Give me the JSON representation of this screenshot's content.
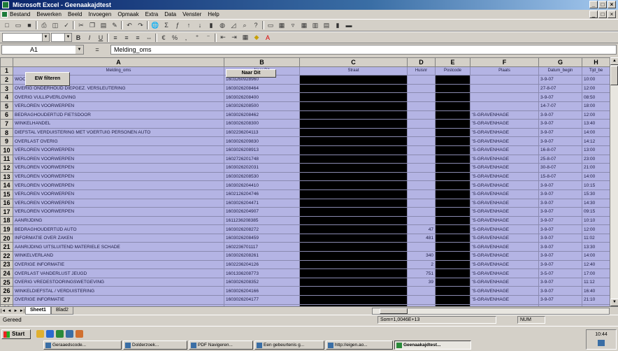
{
  "window": {
    "title": "Microsoft Excel - Geenaakajdtest"
  },
  "menu": [
    "Bestand",
    "Bewerken",
    "Beeld",
    "Invoegen",
    "Opmaak",
    "Extra",
    "Data",
    "Venster",
    "Help"
  ],
  "formula_bar": {
    "name_box": "A1",
    "fx": "=",
    "content": "Melding_oms"
  },
  "columns": [
    "A",
    "B",
    "C",
    "D",
    "E",
    "F",
    "G",
    "H"
  ],
  "header_row": {
    "num": "1",
    "cells": [
      "Melding_oms",
      "Naar Dit",
      "Straat",
      "Huisnr",
      "Postcode",
      "Plaats",
      "Datum_begin",
      "Tijd_be"
    ]
  },
  "buttons": {
    "ew": "EW filteren",
    "naar": "Naar Dit"
  },
  "rows": [
    {
      "n": "2",
      "a": "WOONLAGEN ZAKEN",
      "b": "1603260928960",
      "d": "",
      "f": "",
      "g": "3-9-07",
      "h": "10:00"
    },
    {
      "n": "3",
      "a": "OVERIG ONDERHOUD DIEPGEZ. VERSLEUTERING",
      "b": "1603026208464",
      "d": "",
      "f": "",
      "g": "27-8-07",
      "h": "12:00"
    },
    {
      "n": "4",
      "a": "OVERIG VULLIPVERLOVING",
      "b": "1603026208400",
      "d": "",
      "f": "",
      "g": "3-9-07",
      "h": "08:50"
    },
    {
      "n": "5",
      "a": "VERLOREN VOORWERPEN",
      "b": "1603026208500",
      "d": "",
      "f": "",
      "g": "14-7-07",
      "h": "18:00"
    },
    {
      "n": "6",
      "a": "BEDRAGHOUDERTIJD FIETSDOOR",
      "b": "1603026208462",
      "d": "",
      "f": "'S-GRAVENHAGE",
      "g": "3-9-07",
      "h": "12:00"
    },
    {
      "n": "7",
      "a": "WINKELHANDEL",
      "b": "1603026208300",
      "d": "",
      "f": "'S-GRAVENHAGE",
      "g": "3-9-07",
      "h": "13:40"
    },
    {
      "n": "8",
      "a": "DIEFSTAL VERDUISTERING MET VOERTUIG PERSONEN AUTO",
      "b": "1602236204113",
      "d": "",
      "f": "'S-GRAVENHAGE",
      "g": "3-9-07",
      "h": "14:00"
    },
    {
      "n": "9",
      "a": "OVERLAST OVERIG",
      "b": "1603026209830",
      "d": "",
      "f": "'S-GRAVENHAGE",
      "g": "3-9-07",
      "h": "14:12"
    },
    {
      "n": "10",
      "a": "VERLOREN VOORWERPEN",
      "b": "1603026208913",
      "d": "",
      "f": "'S-GRAVENHAGE",
      "g": "16-8-07",
      "h": "13:00"
    },
    {
      "n": "11",
      "a": "VERLOREN VOORWERPEN",
      "b": "1602726201748",
      "d": "",
      "f": "'S-GRAVENHAGE",
      "g": "25-8-07",
      "h": "23:00"
    },
    {
      "n": "12",
      "a": "VERLOREN VOORWERPEN",
      "b": "1603026202031",
      "d": "",
      "f": "'S-GRAVENHAGE",
      "g": "30-8-07",
      "h": "21:00"
    },
    {
      "n": "13",
      "a": "VERLOREN VOORWERPEN",
      "b": "1603026208530",
      "d": "",
      "f": "'S-GRAVENHAGE",
      "g": "15-8-07",
      "h": "14:00"
    },
    {
      "n": "14",
      "a": "VERLOREN VOORWERPEN",
      "b": "1603026204410",
      "d": "",
      "f": "'S-GRAVENHAGE",
      "g": "3-9-07",
      "h": "10:15"
    },
    {
      "n": "15",
      "a": "VERLOREN VOORWERPEN",
      "b": "1602126204746",
      "d": "",
      "f": "'S-GRAVENHAGE",
      "g": "3-9-07",
      "h": "15:30"
    },
    {
      "n": "16",
      "a": "VERLOREN VOORWERPEN",
      "b": "1603026204471",
      "d": "",
      "f": "'S-GRAVENHAGE",
      "g": "3-9-07",
      "h": "14:30"
    },
    {
      "n": "17",
      "a": "VERLOREN VOORWERPEN",
      "b": "1603026204907",
      "d": "",
      "f": "'S-GRAVENHAGE",
      "g": "3-9-07",
      "h": "09:15"
    },
    {
      "n": "18",
      "a": "AANRIJDING",
      "b": "1611236208385",
      "d": "",
      "f": "'S-GRAVENHAGE",
      "g": "3-9-07",
      "h": "10:10"
    },
    {
      "n": "19",
      "a": "BEDRAGHOUDERTIJD AUTO",
      "b": "1603026208272",
      "d": "47",
      "f": "'S-GRAVENHAGE",
      "g": "3-9-07",
      "h": "12:00"
    },
    {
      "n": "20",
      "a": "INFORMATIE OVER ZAKEN",
      "b": "1603026208459",
      "d": "481",
      "f": "'S-GRAVENHAGE",
      "g": "3-9-07",
      "h": "11:02"
    },
    {
      "n": "21",
      "a": "AANRIJDING UITSLUITEND MATERIELE SCHADE",
      "b": "1602236701117",
      "d": "",
      "f": "'S-GRAVENHAGE",
      "g": "3-9-07",
      "h": "13:30"
    },
    {
      "n": "22",
      "a": "WINKELVERLAND",
      "b": "1603026208261",
      "d": "340",
      "f": "'S-GRAVENHAGE",
      "g": "3-9-07",
      "h": "14:00"
    },
    {
      "n": "23",
      "a": "OVERIGE INFORMATIE",
      "b": "1602236204126",
      "d": "2",
      "f": "'S-GRAVENHAGE",
      "g": "3-9-07",
      "h": "12:40"
    },
    {
      "n": "24",
      "a": "OVERLAST VANDERLUST JEUGD",
      "b": "1601336208773",
      "d": "751",
      "f": "'S-GRAVENHAGE",
      "g": "3-5-07",
      "h": "17:00"
    },
    {
      "n": "25",
      "a": "OVERIG VREDESTOORINGSWETGEVING",
      "b": "1603026208352",
      "d": "39",
      "f": "'S-GRAVENHAGE",
      "g": "3-9-07",
      "h": "11:12"
    },
    {
      "n": "26",
      "a": "WINKELDIEFSTAL / VERDUISTERING",
      "b": "1603026204166",
      "d": "",
      "f": "'S-GRAVENHAGE",
      "g": "3-9-07",
      "h": "16:40"
    },
    {
      "n": "27",
      "a": "OVERIGE INFORMATIE",
      "b": "1603026204177",
      "d": "",
      "f": "'S-GRAVENHAGE",
      "g": "3-9-07",
      "h": "21:10"
    },
    {
      "n": "28",
      "a": "VERLOREN VOORWERPEN",
      "b": "1603026204327",
      "d": "",
      "f": "'S-GRAVENHAGE",
      "g": "1-7-07",
      "h": "12:00"
    }
  ],
  "sheet_tabs": [
    "Sheet1",
    "Blad2"
  ],
  "status": {
    "left": "Gereed",
    "sum": "Som=1,0046E+13",
    "mode": "NUM"
  },
  "taskbar": {
    "start": "Start",
    "buttons": [
      "Geraaedscode...",
      "Dolderzoek...",
      "PDF Navigeren...",
      "Een gebeurtenis g...",
      "http://eigen.ao...",
      "Geenaakajdtest..."
    ],
    "clock": "10:44"
  }
}
